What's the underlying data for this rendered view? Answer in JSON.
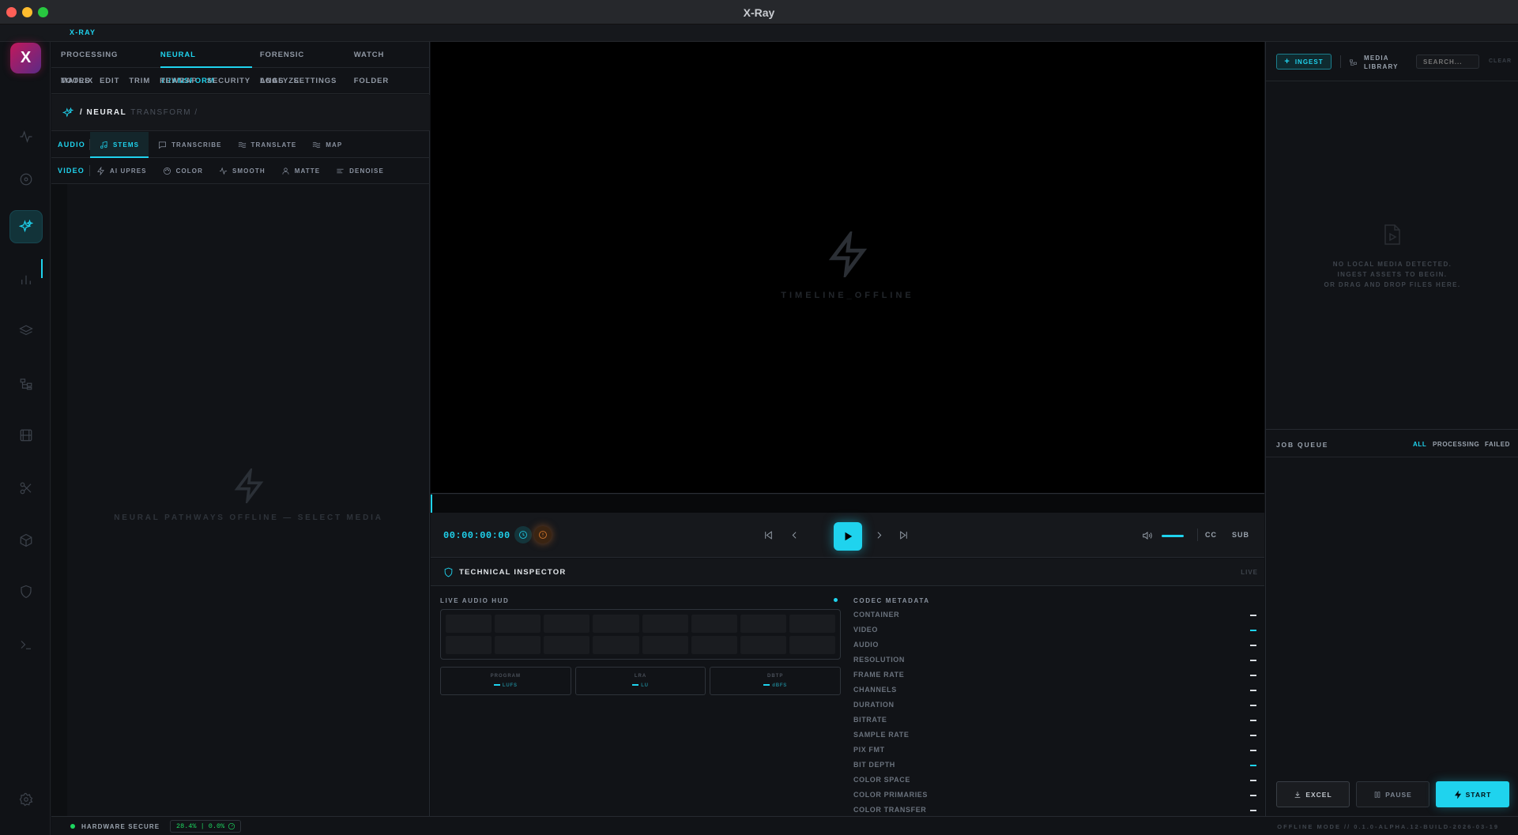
{
  "window": {
    "title": "X-Ray"
  },
  "tabstrip": {
    "app_tab": "X-RAY"
  },
  "rail": {
    "logo": "X",
    "icons": [
      "activity-icon",
      "target-icon",
      "sparkles-icon",
      "bar-chart-icon",
      "layers-icon",
      "folder-tree-icon",
      "film-icon",
      "scissors-icon",
      "box-icon",
      "shield-icon",
      "terminal-icon",
      "gear-icon"
    ]
  },
  "left": {
    "nav_primary": [
      "PROCESSING MATRIX",
      "NEURAL TRANSFORM",
      "FORENSIC ANALYZE",
      "WATCH FOLDER"
    ],
    "nav_secondary": [
      "TOOLS",
      "EDIT",
      "TRIM",
      "REWRAP",
      "SECURITY",
      "LOGS",
      "SETTINGS"
    ],
    "breadcrumb": {
      "current": "/ NEURAL",
      "rest": "TRANSFORM /"
    },
    "audio": {
      "label": "AUDIO",
      "items": [
        "STEMS",
        "TRANSCRIBE",
        "TRANSLATE",
        "MAP"
      ]
    },
    "video": {
      "label": "VIDEO",
      "items": [
        "AI UPRES",
        "COLOR",
        "SMOOTH",
        "MATTE",
        "DENOISE"
      ]
    },
    "empty_message": "NEURAL PATHWAYS OFFLINE — SELECT MEDIA"
  },
  "viewer": {
    "placeholder": "TIMELINE_OFFLINE"
  },
  "transport": {
    "timecode": "00:00:00:00",
    "cc": "CC",
    "sub": "SUB",
    "volume": 1.0
  },
  "inspector": {
    "title": "TECHNICAL INSPECTOR",
    "live": "LIVE",
    "hud_title": "LIVE AUDIO HUD",
    "meters": [
      {
        "label": "PROGRAM",
        "unit": "LUFS"
      },
      {
        "label": "LRA",
        "unit": "LU"
      },
      {
        "label": "DBTP",
        "unit": "dBFS"
      }
    ],
    "codec_title": "CODEC METADATA",
    "codec_rows": [
      "CONTAINER",
      "VIDEO",
      "AUDIO",
      "RESOLUTION",
      "FRAME RATE",
      "CHANNELS",
      "DURATION",
      "BITRATE",
      "SAMPLE RATE",
      "PIX FMT",
      "BIT DEPTH",
      "COLOR SPACE",
      "COLOR PRIMARIES",
      "COLOR TRANSFER"
    ],
    "codec_value": "—"
  },
  "library": {
    "ingest": "INGEST",
    "title_line1": "MEDIA",
    "title_line2": "LIBRARY",
    "search_placeholder": "SEARCH...",
    "clear": "CLEAR",
    "empty_lines": [
      "NO LOCAL MEDIA DETECTED.",
      "INGEST ASSETS TO BEGIN.",
      "OR DRAG AND DROP FILES HERE."
    ]
  },
  "queue": {
    "title": "JOB QUEUE",
    "filters": [
      "ALL",
      "PROCESSING",
      "FAILED"
    ],
    "excel": "EXCEL",
    "pause": "PAUSE",
    "start": "START"
  },
  "status": {
    "hardware": "HARDWARE SECURE",
    "usage": "28.4% | 0.0%",
    "version": "OFFLINE MODE // 0.1.0-ALPHA.12-BUILD-2026-03-19"
  },
  "colors": {
    "accent": "#1fd3ee",
    "ok": "#1ed760",
    "warn": "#e07a2a"
  }
}
